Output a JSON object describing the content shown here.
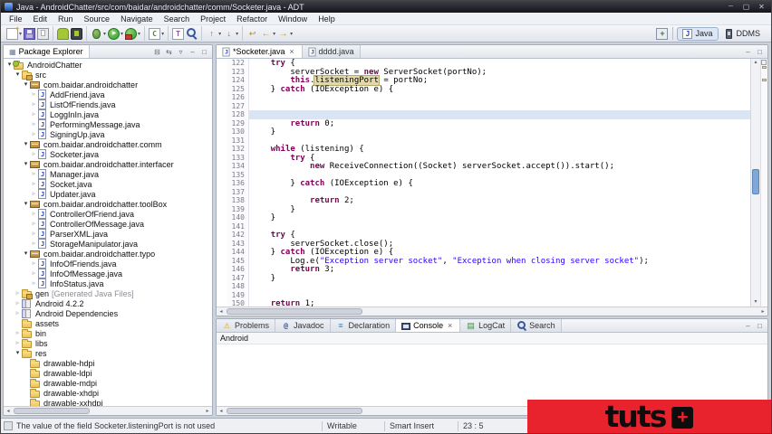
{
  "window": {
    "title": "Java - AndroidChatter/src/com/baidar/androidchatter/comm/Socketer.java - ADT",
    "controls": [
      "minimize",
      "maximize",
      "close"
    ]
  },
  "menubar": {
    "items": [
      "File",
      "Edit",
      "Run",
      "Source",
      "Navigate",
      "Search",
      "Project",
      "Refactor",
      "Window",
      "Help"
    ]
  },
  "toolbar": {
    "groups": [
      [
        {
          "icon": "new-wizard",
          "dd": true
        },
        {
          "icon": "save"
        },
        {
          "icon": "print"
        }
      ],
      [
        {
          "icon": "android-sdk-manager"
        },
        {
          "icon": "avd-manager"
        }
      ],
      [
        {
          "icon": "debug",
          "dd": true
        },
        {
          "icon": "run",
          "dd": true
        },
        {
          "icon": "external-tools",
          "dd": true
        }
      ],
      [
        {
          "icon": "new-java-class",
          "dd": true
        }
      ],
      [
        {
          "icon": "open-type"
        },
        {
          "icon": "search"
        }
      ],
      [
        {
          "icon": "prev-annotation",
          "dd": true
        },
        {
          "icon": "next-annotation",
          "dd": true
        }
      ],
      [
        {
          "icon": "last-edit-location"
        },
        {
          "icon": "back",
          "dd": true
        },
        {
          "icon": "forward",
          "dd": true
        }
      ]
    ]
  },
  "perspectives": {
    "open_icon": "open-perspective",
    "buttons": [
      {
        "label": "Java",
        "icon": "java-perspective",
        "active": true
      },
      {
        "label": "DDMS",
        "icon": "ddms-perspective",
        "active": false
      }
    ]
  },
  "package_explorer": {
    "title": "Package Explorer",
    "toolbar_icons": [
      "collapse-all",
      "link-with-editor",
      "view-menu",
      "minimize",
      "maximize"
    ],
    "items": [
      {
        "label": "AndroidChatter",
        "depth": 0,
        "icon": "project",
        "state": "open"
      },
      {
        "label": "src",
        "depth": 1,
        "icon": "srcfolder",
        "state": "open"
      },
      {
        "label": "com.baidar.androidchatter",
        "depth": 2,
        "icon": "package",
        "state": "open"
      },
      {
        "label": "AddFriend.java",
        "depth": 3,
        "icon": "jfile",
        "state": "closed"
      },
      {
        "label": "ListOfFriends.java",
        "depth": 3,
        "icon": "jfile",
        "state": "closed"
      },
      {
        "label": "LoggInIn.java",
        "depth": 3,
        "icon": "jfile",
        "state": "closed"
      },
      {
        "label": "PerformingMessage.java",
        "depth": 3,
        "icon": "jfile",
        "state": "closed"
      },
      {
        "label": "SigningUp.java",
        "depth": 3,
        "icon": "jfile",
        "state": "closed"
      },
      {
        "label": "com.baidar.androidchatter.comm",
        "depth": 2,
        "icon": "package",
        "state": "open"
      },
      {
        "label": "Socketer.java",
        "depth": 3,
        "icon": "jfile",
        "state": "closed"
      },
      {
        "label": "com.baidar.androidchatter.interfacer",
        "depth": 2,
        "icon": "package",
        "state": "open"
      },
      {
        "label": "Manager.java",
        "depth": 3,
        "icon": "jfile",
        "state": "closed"
      },
      {
        "label": "Socket.java",
        "depth": 3,
        "icon": "jfile",
        "state": "closed"
      },
      {
        "label": "Updater.java",
        "depth": 3,
        "icon": "jfile",
        "state": "closed"
      },
      {
        "label": "com.baidar.androidchatter.toolBox",
        "depth": 2,
        "icon": "package",
        "state": "open"
      },
      {
        "label": "ControllerOfFriend.java",
        "depth": 3,
        "icon": "jfile",
        "state": "closed"
      },
      {
        "label": "ControllerOfMessage.java",
        "depth": 3,
        "icon": "jfile",
        "state": "closed"
      },
      {
        "label": "ParserXML.java",
        "depth": 3,
        "icon": "jfile",
        "state": "closed"
      },
      {
        "label": "StorageManipulator.java",
        "depth": 3,
        "icon": "jfile",
        "state": "closed"
      },
      {
        "label": "com.baidar.androidchatter.typo",
        "depth": 2,
        "icon": "package",
        "state": "open"
      },
      {
        "label": "InfoOfFriends.java",
        "depth": 3,
        "icon": "jfile",
        "state": "closed"
      },
      {
        "label": "InfoOfMessage.java",
        "depth": 3,
        "icon": "jfile",
        "state": "closed"
      },
      {
        "label": "InfoStatus.java",
        "depth": 3,
        "icon": "jfile",
        "state": "closed"
      },
      {
        "label": "gen",
        "suffix": "[Generated Java Files]",
        "depth": 1,
        "icon": "srcfolder",
        "state": "closed"
      },
      {
        "label": "Android 4.2.2",
        "depth": 1,
        "icon": "library",
        "state": "closed"
      },
      {
        "label": "Android Dependencies",
        "depth": 1,
        "icon": "library",
        "state": "closed"
      },
      {
        "label": "assets",
        "depth": 1,
        "icon": "folder",
        "state": "none"
      },
      {
        "label": "bin",
        "depth": 1,
        "icon": "folder",
        "state": "closed"
      },
      {
        "label": "libs",
        "depth": 1,
        "icon": "folder",
        "state": "closed"
      },
      {
        "label": "res",
        "depth": 1,
        "icon": "folder",
        "state": "open"
      },
      {
        "label": "drawable-hdpi",
        "depth": 2,
        "icon": "folder",
        "state": "none"
      },
      {
        "label": "drawable-ldpi",
        "depth": 2,
        "icon": "folder",
        "state": "none"
      },
      {
        "label": "drawable-mdpi",
        "depth": 2,
        "icon": "folder",
        "state": "none"
      },
      {
        "label": "drawable-xhdpi",
        "depth": 2,
        "icon": "folder",
        "state": "none"
      },
      {
        "label": "drawable-xxhdpi",
        "depth": 2,
        "icon": "folder",
        "state": "none"
      }
    ]
  },
  "editor": {
    "tabs": [
      {
        "label": "*Socketer.java",
        "active": true,
        "closable": true
      },
      {
        "label": "dddd.java",
        "active": false,
        "closable": false
      }
    ],
    "tabbar_icons": [
      "minimize",
      "maximize"
    ],
    "overview_markers": [
      {
        "top_pct": 3
      },
      {
        "top_pct": 8
      }
    ],
    "code": {
      "lines": [
        {
          "n": 122,
          "segs": [
            [
              "pl",
              "    "
            ],
            [
              "kw",
              "try"
            ],
            [
              "pl",
              " {"
            ]
          ]
        },
        {
          "n": 123,
          "segs": [
            [
              "pl",
              "        serverSocket = "
            ],
            [
              "kw",
              "new"
            ],
            [
              "pl",
              " ServerSocket(portNo);"
            ]
          ]
        },
        {
          "n": 124,
          "segs": [
            [
              "pl",
              "        "
            ],
            [
              "kw",
              "this"
            ],
            [
              "pl",
              "."
            ],
            [
              "occ",
              "listeningPort"
            ],
            [
              "pl",
              " = portNo;"
            ]
          ]
        },
        {
          "n": 125,
          "segs": [
            [
              "pl",
              "    } "
            ],
            [
              "kw",
              "catch"
            ],
            [
              "pl",
              " (IOException e) {"
            ]
          ]
        },
        {
          "n": 126,
          "segs": []
        },
        {
          "n": 127,
          "segs": []
        },
        {
          "n": 128,
          "segs": [],
          "current": true
        },
        {
          "n": 129,
          "segs": [
            [
              "pl",
              "        "
            ],
            [
              "kw",
              "return"
            ],
            [
              "pl",
              " 0;"
            ]
          ]
        },
        {
          "n": 130,
          "segs": [
            [
              "pl",
              "    }"
            ]
          ]
        },
        {
          "n": 131,
          "segs": []
        },
        {
          "n": 132,
          "segs": [
            [
              "pl",
              "    "
            ],
            [
              "kw",
              "while"
            ],
            [
              "pl",
              " (listening) {"
            ]
          ]
        },
        {
          "n": 133,
          "segs": [
            [
              "pl",
              "        "
            ],
            [
              "kw",
              "try"
            ],
            [
              "pl",
              " {"
            ]
          ]
        },
        {
          "n": 134,
          "segs": [
            [
              "pl",
              "            "
            ],
            [
              "kw",
              "new"
            ],
            [
              "pl",
              " ReceiveConnection((Socket) serverSocket.accept()).start();"
            ]
          ]
        },
        {
          "n": 135,
          "segs": []
        },
        {
          "n": 136,
          "segs": [
            [
              "pl",
              "        } "
            ],
            [
              "kw",
              "catch"
            ],
            [
              "pl",
              " (IOException e) {"
            ]
          ]
        },
        {
          "n": 137,
          "segs": []
        },
        {
          "n": 138,
          "segs": [
            [
              "pl",
              "            "
            ],
            [
              "kw",
              "return"
            ],
            [
              "pl",
              " 2;"
            ]
          ]
        },
        {
          "n": 139,
          "segs": [
            [
              "pl",
              "        }"
            ]
          ]
        },
        {
          "n": 140,
          "segs": [
            [
              "pl",
              "    }"
            ]
          ]
        },
        {
          "n": 141,
          "segs": []
        },
        {
          "n": 142,
          "segs": [
            [
              "pl",
              "    "
            ],
            [
              "kw",
              "try"
            ],
            [
              "pl",
              " {"
            ]
          ]
        },
        {
          "n": 143,
          "segs": [
            [
              "pl",
              "        serverSocket.close();"
            ]
          ]
        },
        {
          "n": 144,
          "segs": [
            [
              "pl",
              "    } "
            ],
            [
              "kw",
              "catch"
            ],
            [
              "pl",
              " (IOException e) {"
            ]
          ]
        },
        {
          "n": 145,
          "segs": [
            [
              "pl",
              "        Log.e("
            ],
            [
              "str",
              "\"Exception server socket\""
            ],
            [
              "pl",
              ", "
            ],
            [
              "str",
              "\"Exception when closing server socket\""
            ],
            [
              "pl",
              ");"
            ]
          ]
        },
        {
          "n": 146,
          "segs": [
            [
              "pl",
              "        "
            ],
            [
              "kw",
              "return"
            ],
            [
              "pl",
              " 3;"
            ]
          ]
        },
        {
          "n": 147,
          "segs": [
            [
              "pl",
              "    }"
            ]
          ]
        },
        {
          "n": 148,
          "segs": []
        },
        {
          "n": 149,
          "segs": []
        },
        {
          "n": 150,
          "segs": [
            [
              "pl",
              "    "
            ],
            [
              "kw",
              "return"
            ],
            [
              "pl",
              " 1;"
            ]
          ]
        }
      ]
    }
  },
  "bottom_panel": {
    "tabs": [
      {
        "label": "Problems",
        "icon": "problems",
        "active": false
      },
      {
        "label": "Javadoc",
        "icon": "javadoc",
        "active": false
      },
      {
        "label": "Declaration",
        "icon": "declaration",
        "active": false
      },
      {
        "label": "Console",
        "icon": "console",
        "active": true
      },
      {
        "label": "LogCat",
        "icon": "logcat",
        "active": false
      },
      {
        "label": "Search",
        "icon": "search",
        "active": false
      }
    ],
    "tabbar_icons": [
      "minimize",
      "maximize"
    ],
    "console_title": "Android"
  },
  "statusbar": {
    "message": "The value of the field Socketer.listeningPort is not used",
    "writable": "Writable",
    "insert_mode": "Smart Insert",
    "position": "23 : 5"
  },
  "branding": {
    "logo_text": "tuts",
    "logo_plus": "+"
  },
  "colors": {
    "keyword": "#7f0055",
    "string": "#2a00ff",
    "occurrence_bg": "#e2d9a8",
    "occurrence_border": "#b5aa6e",
    "current_line": "#d9e5f5",
    "banner_red": "#e8232e",
    "scrollbar_thumb": "#7fa8d9"
  }
}
